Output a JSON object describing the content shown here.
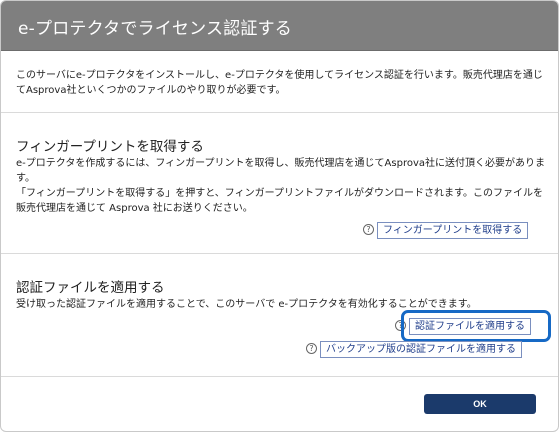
{
  "dialog": {
    "title": "e-プロテクタでライセンス認証する",
    "intro": "このサーバにe-プロテクタをインストールし、e-プロテクタを使用してライセンス認証を行います。販売代理店を通じてAsprova社といくつかのファイルのやり取りが必要です。"
  },
  "fingerprint": {
    "title": "フィンガープリントを取得する",
    "desc_line1": "e-プロテクタを作成するには、フィンガープリントを取得し、販売代理店を通じてAsprova社に送付頂く必要があります。",
    "desc_line2": "「フィンガープリントを取得する」を押すと、フィンガープリントファイルがダウンロードされます。このファイルを販売代理店を通じて Asprova 社にお送りください。",
    "button": "フィンガープリントを取得する"
  },
  "certfile": {
    "title": "認証ファイルを適用する",
    "desc": "受け取った認証ファイルを適用することで、このサーバで e-プロテクタを有効化することができます。",
    "apply_button": "認証ファイルを適用する",
    "backup_button": "バックアップ版の認証ファイルを適用する"
  },
  "help_symbol": "?",
  "ok_label": "OK",
  "colors": {
    "header_bg": "#7f7f7f",
    "link": "#1f3d8a",
    "highlight": "#1669c5",
    "ok_bg": "#1b3a6b"
  },
  "icons": {
    "help": "question-circle-icon"
  }
}
